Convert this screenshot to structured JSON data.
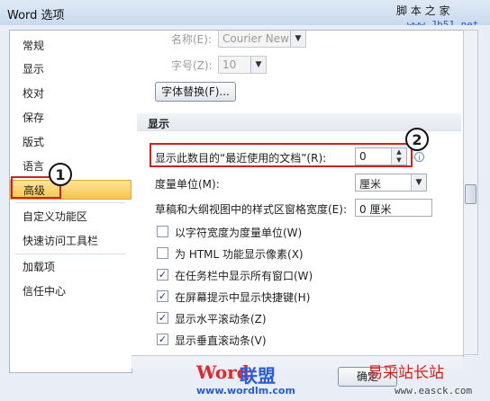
{
  "window": {
    "title": "Word 选项"
  },
  "watermarks": {
    "top": "脚 本 之 家",
    "top_url": "www.Jb51.net",
    "logo_word": "Word",
    "logo_cn": "联盟",
    "logo_url": "www.wordlm.com",
    "right": "易采站长站",
    "right_url": "www.easck.com"
  },
  "sidebar": {
    "items": [
      {
        "label": "常规"
      },
      {
        "label": "显示"
      },
      {
        "label": "校对"
      },
      {
        "label": "保存"
      },
      {
        "label": "版式"
      },
      {
        "label": "语言"
      },
      {
        "label": "高级",
        "selected": true
      },
      {
        "label": "自定义功能区"
      },
      {
        "label": "快速访问工具栏"
      },
      {
        "label": "加载项"
      },
      {
        "label": "信任中心"
      }
    ]
  },
  "content": {
    "font_name_label": "名称(E):",
    "font_name_value": "Courier New",
    "font_size_label": "字号(Z):",
    "font_size_value": "10",
    "font_sub_button": "字体替换(F)...",
    "display_section": "显示",
    "recent_docs_label": "显示此数目的“最近使用的文档”(R):",
    "recent_docs_value": "0",
    "unit_label": "度量单位(M):",
    "unit_value": "厘米",
    "style_width_label": "草稿和大纲视图中的样式区窗格宽度(E):",
    "style_width_value": "0 厘米",
    "options": [
      {
        "label": "以字符宽度为度量单位(W)",
        "checked": false
      },
      {
        "label": "为 HTML 功能显示像素(X)",
        "checked": false
      },
      {
        "label": "在任务栏中显示所有窗口(W)",
        "checked": true
      },
      {
        "label": "在屏幕提示中显示快捷键(H)",
        "checked": true
      },
      {
        "label": "显示水平滚动条(Z)",
        "checked": true
      },
      {
        "label": "显示垂直滚动条(V)",
        "checked": true
      }
    ]
  },
  "buttons": {
    "ok": "确定"
  },
  "annotations": {
    "badge1": "1",
    "badge2": "2"
  },
  "colors": {
    "selection": "#f6c64d",
    "annotation_red": "#d02020"
  }
}
